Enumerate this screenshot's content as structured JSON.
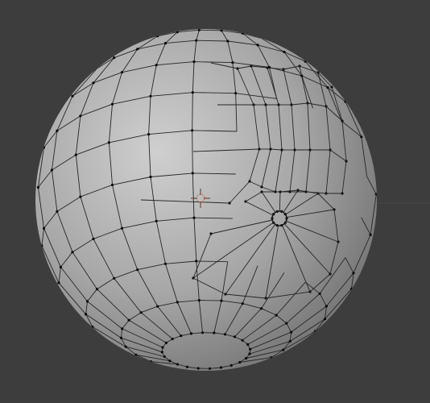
{
  "viewport": {
    "background_color": "#3d3d3d",
    "grid_line_color": "#474747",
    "mesh_fill_color": "#a7a7a7",
    "mesh_highlight_color": "#cfcfcf",
    "mesh_shadow_color": "#6f6f6f",
    "edge_color": "#262626",
    "vertex_color": "#0a0a0a",
    "cursor_color": "#d86a3a"
  },
  "mesh": {
    "object": "uv-sphere",
    "mode": "edit",
    "edges_visible": true,
    "vertices_visible": true,
    "has_retopology_patch": true,
    "has_small_circular_hole": true
  },
  "cursor_3d": {
    "icon": "3d-cursor-icon"
  }
}
